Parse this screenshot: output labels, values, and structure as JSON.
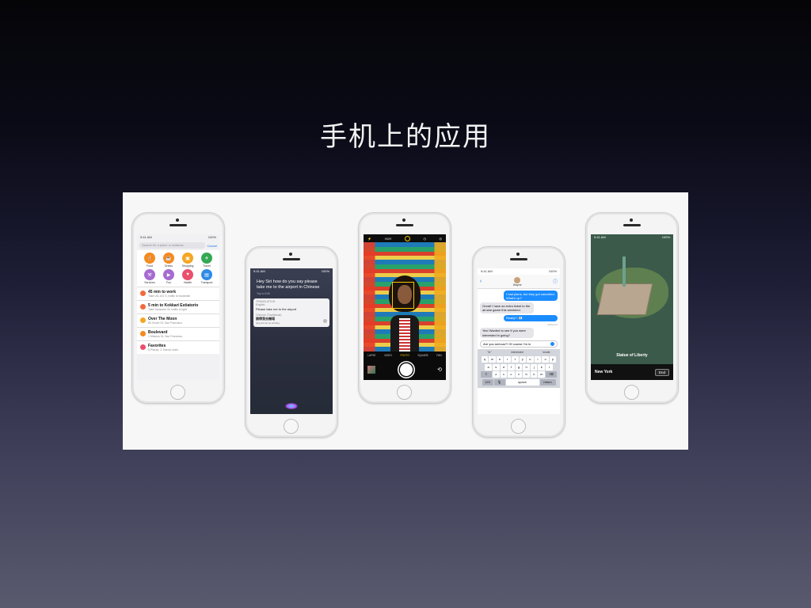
{
  "slide": {
    "title": "手机上的应用"
  },
  "status_bar": {
    "time": "9:41 AM",
    "battery": "100%"
  },
  "maps": {
    "search_placeholder": "Search for a place or address",
    "cancel": "Cancel",
    "categories": [
      {
        "label": "Food",
        "icon": "fork-knife-icon",
        "color": "#f58a1f"
      },
      {
        "label": "Drinks",
        "icon": "cup-icon",
        "color": "#f58a1f"
      },
      {
        "label": "Shopping",
        "icon": "bag-icon",
        "color": "#f5a623"
      },
      {
        "label": "Travel",
        "icon": "plane-icon",
        "color": "#34a853"
      },
      {
        "label": "Services",
        "icon": "wrench-icon",
        "color": "#a66bd1"
      },
      {
        "label": "Fun",
        "icon": "film-icon",
        "color": "#a66bd1"
      },
      {
        "label": "Health",
        "icon": "heart-icon",
        "color": "#ea4f6c"
      },
      {
        "label": "Transport",
        "icon": "bus-icon",
        "color": "#2f8be6"
      }
    ],
    "rows": [
      {
        "title": "45 min to work",
        "subtitle": "Take US-101 S, traffic is moderate",
        "color": "#f26a3c"
      },
      {
        "title": "5 min to Kokkari Estiatorio",
        "subtitle": "Take Sansome St, traffic is light",
        "color": "#f26a3c"
      },
      {
        "title": "Over The Moon",
        "subtitle": "80 Grove St, San Francisco",
        "color": "#f5a623"
      },
      {
        "title": "Boulevard",
        "subtitle": "1 Mission St, San Francisco",
        "color": "#f58a1f"
      },
      {
        "title": "Favorites",
        "subtitle": "5 Places, 3 Transit Lines",
        "color": "#ea4f6c"
      }
    ]
  },
  "siri": {
    "query": "Hey Siri how do you say please take me to the airport in Chinese",
    "tap_to_edit": "Tap to Edit",
    "card_header": "TRANSLATION",
    "source_lang": "English",
    "source_text": "Please take me to the airport",
    "target_lang": "Chinese (Traditional)",
    "target_text": "請帶我去機場",
    "pinyin": "qǐng dài wǒ qù jīchǎng"
  },
  "camera": {
    "hdr": "HDR",
    "modes": [
      "LAPSE",
      "VIDEO",
      "PHOTO",
      "SQUARE",
      "PAN"
    ],
    "active_mode": "PHOTO"
  },
  "messages": {
    "contact": "Wayne",
    "bubbles": [
      {
        "dir": "out",
        "text": "I had plans, but they got cancelled. What's up?"
      },
      {
        "dir": "in",
        "text": "Great! I have an extra ticket to the all-star game this weekend."
      },
      {
        "dir": "out",
        "text": "Really!? 👀"
      },
      {
        "dir": "in",
        "text": "Yes! Wanted to see if you were interested in going?"
      }
    ],
    "delivered": "Delivered",
    "compose_text": "Are you serious?! Of course I'm in",
    "predictions": [
      "\"in\"",
      "interested",
      "inside"
    ],
    "keyboard": {
      "row1": [
        "q",
        "w",
        "e",
        "r",
        "t",
        "y",
        "u",
        "i",
        "o",
        "p"
      ],
      "row2": [
        "a",
        "s",
        "d",
        "f",
        "g",
        "h",
        "j",
        "k",
        "l"
      ],
      "row3": [
        "z",
        "x",
        "c",
        "v",
        "b",
        "n",
        "m"
      ],
      "num": "123",
      "space": "space",
      "return": "return"
    }
  },
  "map3d": {
    "landmark": "Statue of Liberty",
    "city": "New York",
    "end_button": "End"
  }
}
